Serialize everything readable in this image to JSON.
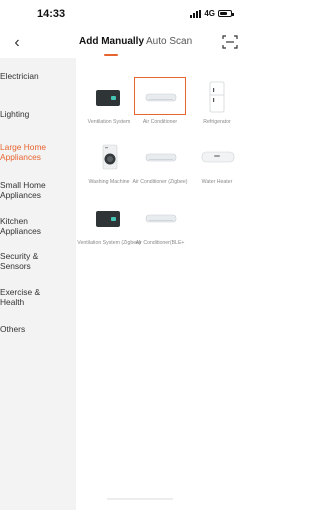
{
  "status_bar": {
    "time": "14:33",
    "network": "4G"
  },
  "header": {
    "tabs": [
      {
        "label": "Add Manually",
        "active": true
      },
      {
        "label": "Auto Scan",
        "active": false
      }
    ],
    "back_icon": "chevron-left-icon",
    "scan_icon": "scan-frame-icon",
    "accent_color": "#e8642f"
  },
  "sidebar": {
    "items": [
      {
        "label": "Electrician",
        "active": false
      },
      {
        "label": "Lighting",
        "active": false
      },
      {
        "label": "Large Home Appliances",
        "active": true
      },
      {
        "label": "Small Home Appliances",
        "active": false
      },
      {
        "label": "Kitchen Appliances",
        "active": false
      },
      {
        "label": "Security & Sensors",
        "active": false
      },
      {
        "label": "Exercise & Health",
        "active": false
      },
      {
        "label": "Others",
        "active": false
      }
    ]
  },
  "devices": [
    {
      "label": "Ventilation System",
      "icon": "ventilation-unit-icon",
      "selected": false
    },
    {
      "label": "Air Conditioner",
      "icon": "air-conditioner-icon",
      "selected": true
    },
    {
      "label": "Refrigerator",
      "icon": "refrigerator-icon",
      "selected": false
    },
    {
      "label": "Washing Machine",
      "icon": "washing-machine-icon",
      "selected": false
    },
    {
      "label": "Air Conditioner (Zigbee)",
      "icon": "air-conditioner-icon",
      "selected": false
    },
    {
      "label": "Water Heater",
      "icon": "water-heater-icon",
      "selected": false
    },
    {
      "label": "Ventilation System (Zigbee)",
      "icon": "ventilation-unit-icon",
      "selected": false
    },
    {
      "label": "Air Conditioner(BLE+",
      "icon": "air-conditioner-icon",
      "selected": false
    }
  ]
}
